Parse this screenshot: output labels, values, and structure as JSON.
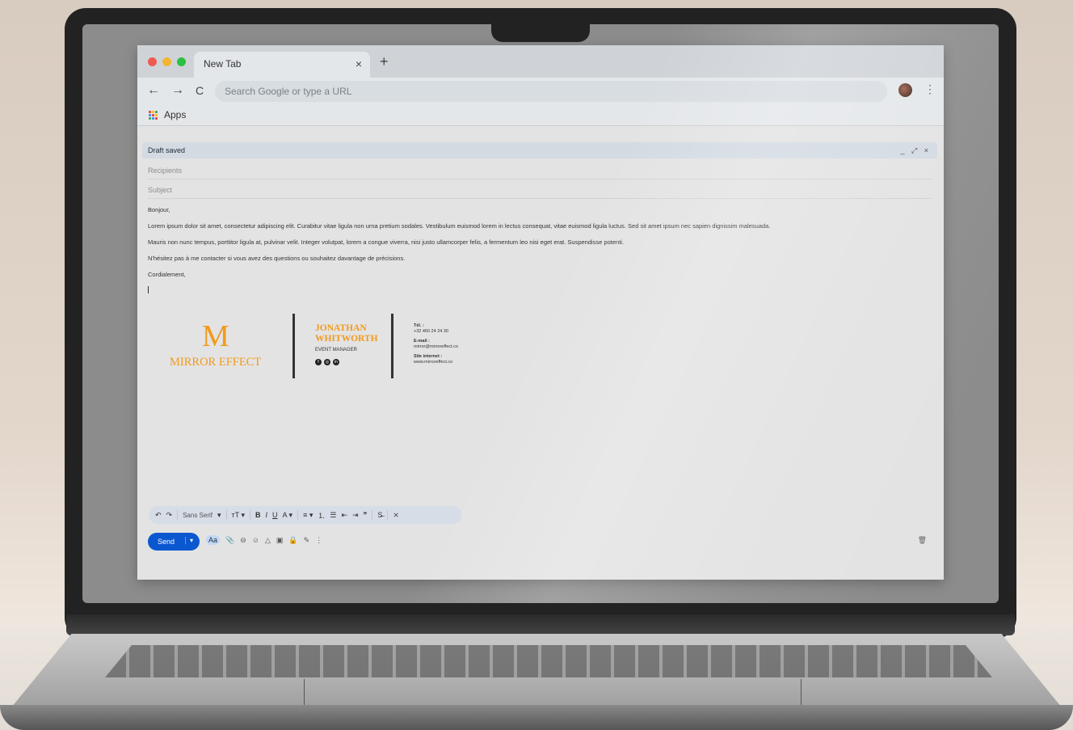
{
  "browser": {
    "tab_title": "New Tab",
    "tab_close": "×",
    "new_tab": "+",
    "back": "←",
    "forward": "→",
    "reload": "C",
    "omnibox_placeholder": "Search Google or type a URL",
    "menu": "⋮",
    "bookmarks_apps": "Apps"
  },
  "compose": {
    "header_status": "Draft saved",
    "window_controls": "_ ⤢ ×",
    "recipients_placeholder": "Recipients",
    "subject_placeholder": "Subject",
    "body": [
      "Bonjour,",
      "Lorem ipsum dolor sit amet, consectetur adipiscing elit. Curabitur vitae ligula non urna pretium sodales. Vestibulum euismod lorem in lectus consequat, vitae euismod ligula luctus. Sed sit amet ipsum nec sapien dignissim malesuada.",
      "Mauris non nunc tempus, porttitor ligula at, pulvinar velit. Integer volutpat, lorem a congue viverra, nisi justo ullamcorper felis, a fermentum leo nisi eget erat. Suspendisse potenti.",
      "N'hésitez pas à me contacter si vous avez des questions ou souhaitez davantage de précisions.",
      "Cordialement,"
    ],
    "signature": {
      "logo_letter": "M",
      "company": "MIRROR EFFECT",
      "name_line1": "JONATHAN",
      "name_line2": "WHITWORTH",
      "role": "EVENT MANAGER",
      "social": [
        "f",
        "◎",
        "in"
      ],
      "tel_label": "Tél. :",
      "tel": "+32 460 24 24 30",
      "email_label": "E-mail :",
      "email": "mirror@mirroreffect.co",
      "site_label": "Site internet :",
      "site": "www.mirroreffect.co"
    },
    "format_bar": {
      "undo": "↶",
      "redo": "↷",
      "font": "Sans Serif",
      "font_arrow": "▾",
      "size": "тT ▾",
      "bold": "B",
      "italic": "I",
      "underline": "U",
      "text_color": "A ▾",
      "align": "≡ ▾",
      "numbered_list": "⒈",
      "bulleted_list": "☰",
      "indent_less": "⇤",
      "indent_more": "⇥",
      "quote": "❞",
      "strikethrough": "S̶",
      "clear_formatting": "⨯"
    },
    "send_label": "Send",
    "send_options": "▾",
    "tools": [
      "Aa",
      "📎",
      "⊖",
      "☺",
      "△",
      "▣",
      "🔒",
      "✎",
      "⋮"
    ],
    "discard": "🗑"
  },
  "colors": {
    "accent_blue": "#0b57d0",
    "brand_orange": "#f29a1c"
  }
}
